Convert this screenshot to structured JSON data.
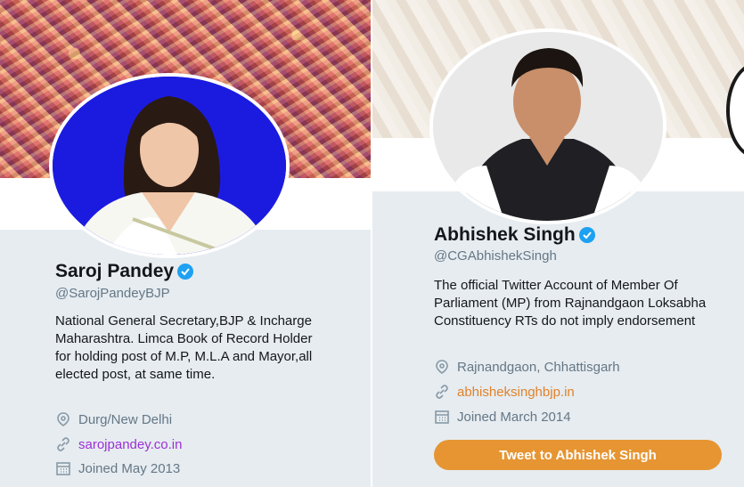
{
  "left_profile": {
    "name": "Saroj Pandey",
    "handle": "@SarojPandeyBJP",
    "bio": "National General Secretary,BJP & Incharge Maharashtra. Limca Book of Record Holder for holding post of M.P, M.L.A and Mayor,all elected post, at same time.",
    "location": "Durg/New Delhi",
    "website": "sarojpandey.co.in",
    "joined": "Joined May 2013"
  },
  "right_profile": {
    "name": "Abhishek Singh",
    "handle": "@CGAbhishekSingh",
    "bio": "The official Twitter Account of Member Of Parliament (MP) from Rajnandgaon Loksabha Constituency RTs do not imply endorsement",
    "location": "Rajnandgaon, Chhattisgarh",
    "website": "abhisheksinghbjp.in",
    "joined": "Joined March 2014",
    "tweet_button": "Tweet to Abhishek Singh"
  },
  "icons": [
    "verified-badge-icon",
    "location-pin-icon",
    "link-icon",
    "calendar-icon"
  ],
  "colors": {
    "card_bg": "#e6ecf0",
    "verified": "#1da1f2",
    "link_left": "#9b30d6",
    "link_right": "#e1822a",
    "tweet_button": "#e69532"
  }
}
